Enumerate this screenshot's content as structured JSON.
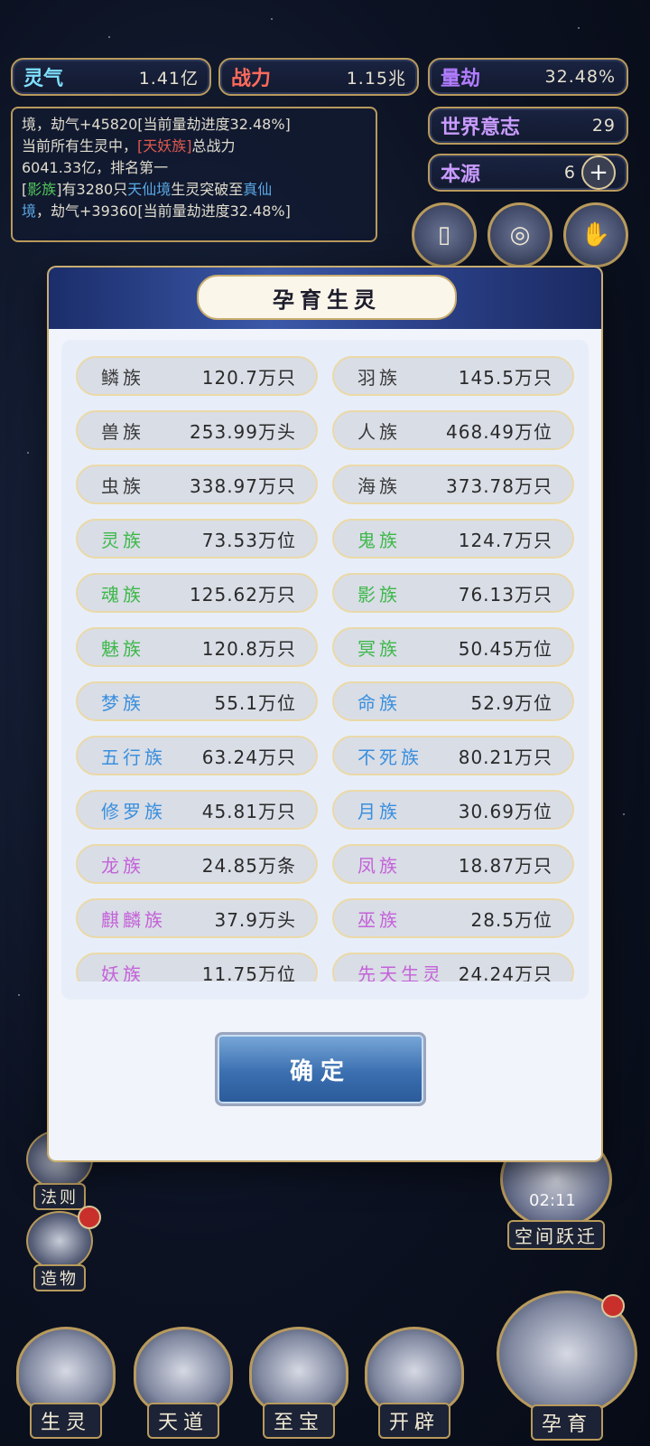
{
  "top": {
    "lingqi": {
      "label": "灵气",
      "value": "1.41亿"
    },
    "zhanli": {
      "label": "战力",
      "value": "1.15兆"
    },
    "liangjie": {
      "label": "量劫",
      "value": "32.48%"
    },
    "world_will": {
      "label": "世界意志",
      "value": "29"
    },
    "origin": {
      "label": "本源",
      "value": "6",
      "plus": "+"
    }
  },
  "log": {
    "line1": "境，劫气+45820[当前量劫进度32.48%]",
    "line2a": "当前所有生灵中，",
    "line2b": "[天妖族]",
    "line2c": "总战力",
    "line3": "6041.33亿，排名第一",
    "line4a": "[",
    "line4b": "影族",
    "line4c": "]有3280只",
    "line4d": "天仙境",
    "line4e": "生灵突破至",
    "line4f": "真仙",
    "line5a": "境",
    "line5b": "，劫气+39360[当前量劫进度32.48%]"
  },
  "modal": {
    "title": "孕育生灵",
    "confirm": "确定",
    "races": [
      {
        "name": "鳞族",
        "amount": "120.7万只",
        "color": "gray"
      },
      {
        "name": "羽族",
        "amount": "145.5万只",
        "color": "gray"
      },
      {
        "name": "兽族",
        "amount": "253.99万头",
        "color": "gray"
      },
      {
        "name": "人族",
        "amount": "468.49万位",
        "color": "gray"
      },
      {
        "name": "虫族",
        "amount": "338.97万只",
        "color": "gray"
      },
      {
        "name": "海族",
        "amount": "373.78万只",
        "color": "gray"
      },
      {
        "name": "灵族",
        "amount": "73.53万位",
        "color": "green"
      },
      {
        "name": "鬼族",
        "amount": "124.7万只",
        "color": "green"
      },
      {
        "name": "魂族",
        "amount": "125.62万只",
        "color": "green"
      },
      {
        "name": "影族",
        "amount": "76.13万只",
        "color": "green"
      },
      {
        "name": "魅族",
        "amount": "120.8万只",
        "color": "green"
      },
      {
        "name": "冥族",
        "amount": "50.45万位",
        "color": "green"
      },
      {
        "name": "梦族",
        "amount": "55.1万位",
        "color": "blue"
      },
      {
        "name": "命族",
        "amount": "52.9万位",
        "color": "blue"
      },
      {
        "name": "五行族",
        "amount": "63.24万只",
        "color": "blue"
      },
      {
        "name": "不死族",
        "amount": "80.21万只",
        "color": "blue"
      },
      {
        "name": "修罗族",
        "amount": "45.81万只",
        "color": "blue"
      },
      {
        "name": "月族",
        "amount": "30.69万位",
        "color": "blue"
      },
      {
        "name": "龙族",
        "amount": "24.85万条",
        "color": "purple"
      },
      {
        "name": "凤族",
        "amount": "18.87万只",
        "color": "purple"
      },
      {
        "name": "麒麟族",
        "amount": "37.9万头",
        "color": "purple"
      },
      {
        "name": "巫族",
        "amount": "28.5万位",
        "color": "purple"
      },
      {
        "name": "妖族",
        "amount": "11.75万位",
        "color": "purple"
      },
      {
        "name": "先天生灵",
        "amount": "24.24万只",
        "color": "purple"
      }
    ]
  },
  "side": {
    "fazé": "法则",
    "zaowu": "造物",
    "space_jump": "空间跃迁",
    "timer": "02:11"
  },
  "nav": {
    "shengling": "生灵",
    "tiandao": "天道",
    "zhibao": "至宝",
    "kaipi": "开辟",
    "yunyu": "孕育"
  }
}
